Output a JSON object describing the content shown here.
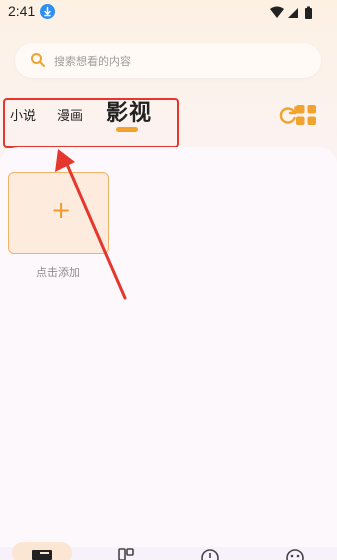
{
  "status_bar": {
    "time": "2:41",
    "icons": [
      "download-icon",
      "wifi-icon",
      "signal-icon",
      "battery-icon"
    ]
  },
  "search": {
    "placeholder": "搜索想看的内容"
  },
  "tabs": [
    {
      "label": "小说",
      "active": false
    },
    {
      "label": "漫画",
      "active": false
    },
    {
      "label": "影视",
      "active": true
    }
  ],
  "toolbar": {
    "refresh_icon": "refresh-icon",
    "grid_icon": "grid-icon"
  },
  "add_card": {
    "symbol": "+",
    "label": "点击添加"
  },
  "bottom_nav": {
    "items": [
      "bookshelf-icon",
      "discover-icon",
      "history-icon",
      "profile-icon"
    ],
    "active_index": 0
  },
  "colors": {
    "accent": "#f1a32d",
    "annotation_red": "#e5372d",
    "download_badge": "#2f8ff0"
  }
}
